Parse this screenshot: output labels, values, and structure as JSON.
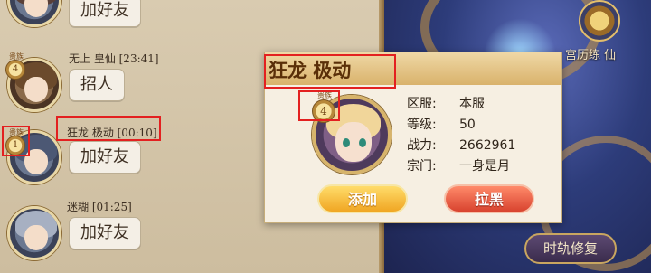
{
  "chat": {
    "messages": [
      {
        "bubble": "加好友"
      },
      {
        "name": "无上 皇仙 [23:41]",
        "bubble": "招人",
        "rank_level": "4",
        "rank_title": "贵族"
      },
      {
        "name": "狂龙 极动 [00:10]",
        "bubble": "加好友",
        "rank_level": "1",
        "rank_title": "贵族"
      },
      {
        "name": "迷糊 [01:25]",
        "bubble": "加好友"
      }
    ]
  },
  "scenery": {
    "top_label": "宫历练  仙",
    "repair_button": "时轨修复"
  },
  "popup": {
    "title": "狂龙 极动",
    "rank_level": "4",
    "rank_title": "贵族",
    "info": [
      {
        "label": "区服:",
        "value": "本服"
      },
      {
        "label": "等级:",
        "value": "50"
      },
      {
        "label": "战力:",
        "value": "2662961"
      },
      {
        "label": "宗门:",
        "value": "一身是月"
      }
    ],
    "add_button": "添加",
    "block_button": "拉黑"
  },
  "colors": {
    "highlight_box": "#e32020",
    "add_button": "#f0a623",
    "block_button": "#d8432f"
  }
}
